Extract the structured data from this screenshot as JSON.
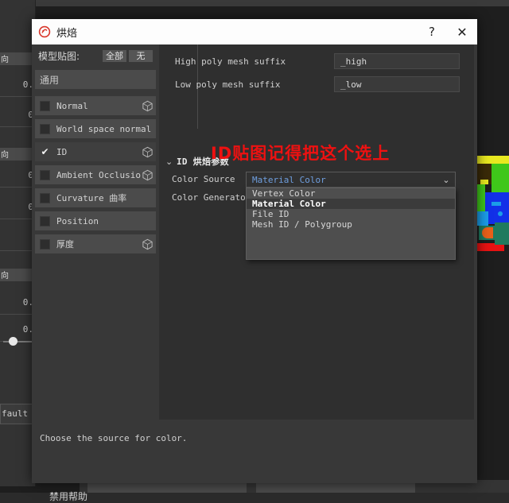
{
  "background": {
    "left_panel_values": [
      "0.",
      "0",
      "0",
      "0",
      "0.",
      "0."
    ],
    "left_panel_group_labels": [
      "向",
      "向",
      "向"
    ],
    "default_button_label": "fault"
  },
  "dialog": {
    "title": "烘焙",
    "title_icon": "bake-icon",
    "help_button": "?",
    "close_button": "✕",
    "left": {
      "maps_label": "模型贴图:",
      "all_button": "全部",
      "none_button": "无",
      "filter_value": "通用",
      "maps": [
        {
          "label": "Normal",
          "checked": false,
          "has_cube": true
        },
        {
          "label": "World space normal",
          "checked": false,
          "has_cube": false
        },
        {
          "label": "ID",
          "checked": true,
          "has_cube": true
        },
        {
          "label": "Ambient Occlusion",
          "checked": false,
          "has_cube": true
        },
        {
          "label": "Curvature 曲率",
          "checked": false,
          "has_cube": false
        },
        {
          "label": "Position",
          "checked": false,
          "has_cube": false
        },
        {
          "label": "厚度",
          "checked": false,
          "has_cube": true
        }
      ]
    },
    "main": {
      "high_poly_label": "High poly mesh suffix",
      "high_poly_value": "_high",
      "low_poly_label": "Low poly mesh suffix",
      "low_poly_value": "_low",
      "group_chevron": "⌄",
      "group_title": "ID 烘焙参数",
      "color_source_label": "Color Source",
      "color_generator_label": "Color Generator",
      "color_source_value": "Material Color",
      "combo_arrow": "⌄",
      "dropdown_options": [
        "Vertex Color",
        "Material Color",
        "File ID",
        "Mesh ID / Polygroup"
      ],
      "dropdown_selected_index": 1,
      "annotation": "ID贴图记得把这个选上",
      "annotation_color": "#ee1111"
    },
    "help_text": "Choose the source for color.",
    "disable_help_label": "禁用帮助"
  }
}
